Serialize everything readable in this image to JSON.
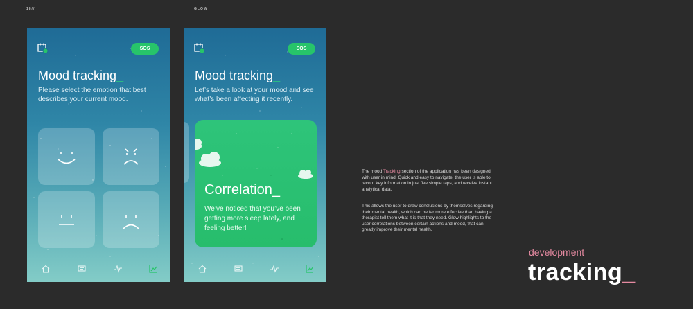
{
  "page": {
    "number": "18//",
    "section": "GLOW"
  },
  "screen1": {
    "sos": "SOS",
    "title": "Mood tracking",
    "title_cursor": "_",
    "subtitle": "Please select the emotion that best describes your current mood.",
    "moods": [
      "happy-face-icon",
      "angry-face-icon",
      "neutral-face-icon",
      "sad-face-icon"
    ]
  },
  "screen2": {
    "sos": "SOS",
    "title": "Mood tracking",
    "title_cursor": "_",
    "subtitle": "Let’s take a look at your mood and see what’s been affecting it recently.",
    "card": {
      "title": "Correlation",
      "title_cursor": "_",
      "text": "We’ve noticed that you’ve been getting more sleep lately, and feeling better!"
    }
  },
  "nav": [
    "home-icon",
    "chat-icon",
    "pulse-icon",
    "chart-icon"
  ],
  "description": {
    "p1_before": "The mood ",
    "p1_highlight": "Tracking",
    "p1_after": " section of the application has been designed with user in mind. Quick and easy to navigate, the user is able to record key information in just five simple taps, and receive instant analytical data.",
    "p2": "This allows the user to draw conclusions by themselves regarding their mental health, which can be far more effective than having a therapist tell them what it is that they need. Glow highlights to the user correlations between certain actions and mood, that can greatly improve their mental health."
  },
  "heading": {
    "eyebrow": "development",
    "title": "tracking",
    "cursor": "_"
  },
  "colors": {
    "accent_green": "#27c46a",
    "accent_pink": "#e58aa1",
    "background": "#2b2b2b"
  }
}
